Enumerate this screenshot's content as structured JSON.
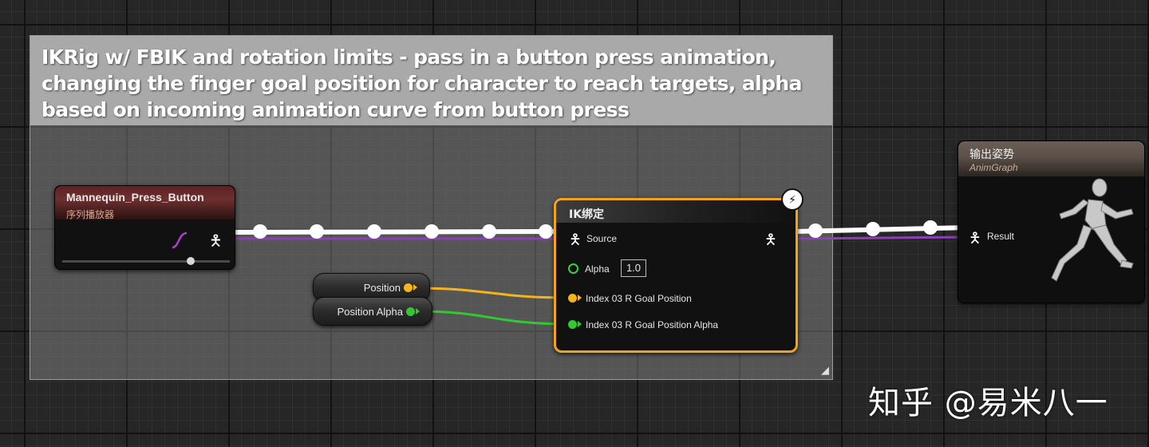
{
  "comment": {
    "text": "IKRig w/ FBIK and rotation limits - pass in a button press animation, changing the finger goal position for character to reach targets, alpha based on incoming animation curve from button press"
  },
  "sequence_node": {
    "title": "Mannequin_Press_Button",
    "subtitle": "序列播放器",
    "icon": "curve-icon",
    "pin_icon": "person-pin-icon"
  },
  "variables": {
    "position": {
      "label": "Position",
      "color": "#f2b51d"
    },
    "position_alpha": {
      "label": "Position Alpha",
      "color": "#32c832"
    }
  },
  "ik_node": {
    "title": "IK绑定",
    "source_label": "Source",
    "alpha_label": "Alpha",
    "alpha_value": "1.0",
    "goal_position_label": "Index 03 R Goal Position",
    "goal_alpha_label": "Index 03 R Goal Position Alpha",
    "badge_icon": "lightning-icon",
    "accent": "#f0a41e"
  },
  "output_node": {
    "title": "输出姿势",
    "subtitle": "AnimGraph",
    "result_label": "Result",
    "preview_icon": "running-mannequin-icon"
  },
  "wires": {
    "exec_color": "#ffffff",
    "pose_color": "#8d3fb5",
    "position_color": "#f2b51d",
    "alpha_color": "#32c832"
  },
  "watermark": "知乎 @易米八一"
}
